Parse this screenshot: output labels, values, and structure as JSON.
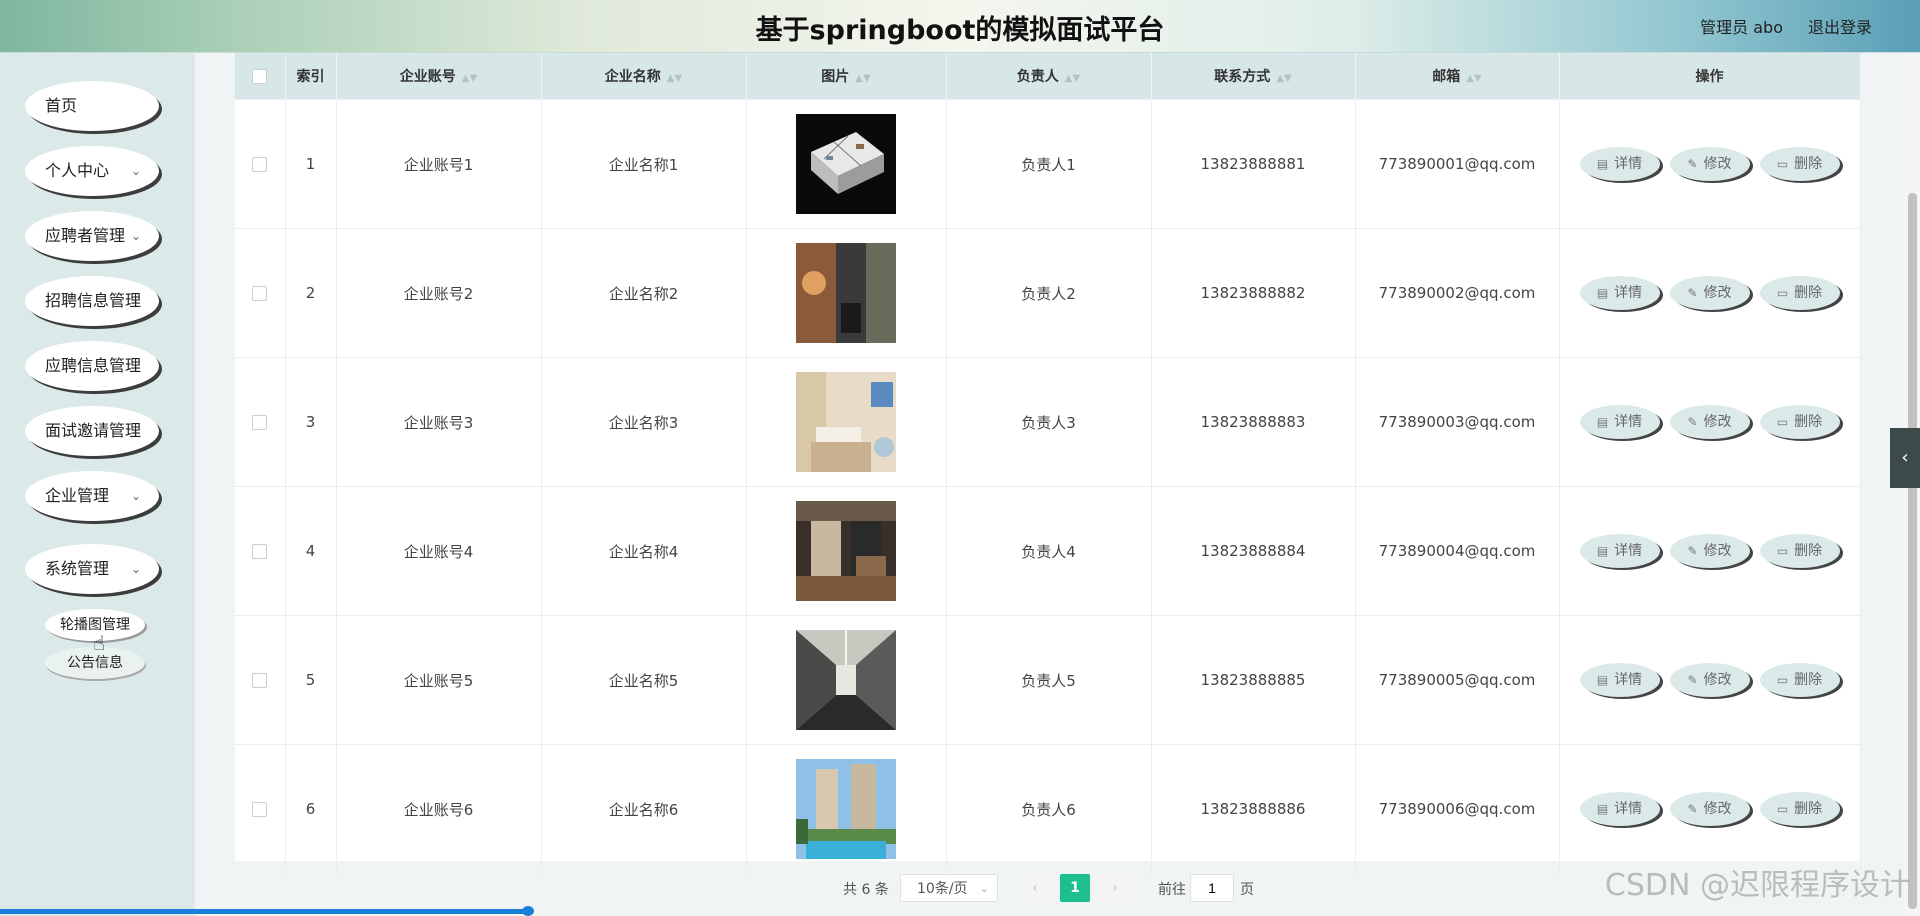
{
  "header": {
    "title": "基于springboot的模拟面试平台",
    "user_label": "管理员 abo",
    "logout_label": "退出登录"
  },
  "sidebar": {
    "items": [
      {
        "label": "首页",
        "has_chevron": false
      },
      {
        "label": "个人中心",
        "has_chevron": true
      },
      {
        "label": "应聘者管理",
        "has_chevron": true
      },
      {
        "label": "招聘信息管理",
        "has_chevron": false
      },
      {
        "label": "应聘信息管理",
        "has_chevron": false
      },
      {
        "label": "面试邀请管理",
        "has_chevron": false
      },
      {
        "label": "企业管理",
        "has_chevron": true
      },
      {
        "label": "系统管理",
        "has_chevron": true
      }
    ],
    "sub_items": [
      {
        "label": "轮播图管理"
      },
      {
        "label": "公告信息"
      }
    ]
  },
  "table": {
    "headers": {
      "index": "索引",
      "account": "企业账号",
      "name": "企业名称",
      "image": "图片",
      "manager": "负责人",
      "contact": "联系方式",
      "email": "邮箱",
      "actions": "操作"
    },
    "actions": {
      "detail": "详情",
      "edit": "修改",
      "delete": "删除"
    },
    "rows": [
      {
        "index": "1",
        "account": "企业账号1",
        "name": "企业名称1",
        "manager": "负责人1",
        "contact": "13823888881",
        "email": "773890001@qq.com",
        "image": "floor-plan-image"
      },
      {
        "index": "2",
        "account": "企业账号2",
        "name": "企业名称2",
        "manager": "负责人2",
        "contact": "13823888882",
        "email": "773890002@qq.com",
        "image": "interior-room-image"
      },
      {
        "index": "3",
        "account": "企业账号3",
        "name": "企业名称3",
        "manager": "负责人3",
        "contact": "13823888883",
        "email": "773890003@qq.com",
        "image": "bedroom-image"
      },
      {
        "index": "4",
        "account": "企业账号4",
        "name": "企业名称4",
        "manager": "负责人4",
        "contact": "13823888884",
        "email": "773890004@qq.com",
        "image": "lobby-image"
      },
      {
        "index": "5",
        "account": "企业账号5",
        "name": "企业名称5",
        "manager": "负责人5",
        "contact": "13823888885",
        "email": "773890005@qq.com",
        "image": "hallway-image"
      },
      {
        "index": "6",
        "account": "企业账号6",
        "name": "企业名称6",
        "manager": "负责人6",
        "contact": "13823888886",
        "email": "773890006@qq.com",
        "image": "building-pool-image"
      }
    ]
  },
  "pagination": {
    "total": "共 6 条",
    "page_size": "10条/页",
    "prev": "‹",
    "current_page": "1",
    "next": "›",
    "goto_label": "前往",
    "goto_value": "1",
    "page_unit": "页"
  },
  "watermark": "CSDN @迟限程序设计",
  "colors": {
    "accent": "#1ebf8e",
    "sidebar_bg": "#dbe9e9",
    "table_header_bg": "#d7e7e7"
  }
}
